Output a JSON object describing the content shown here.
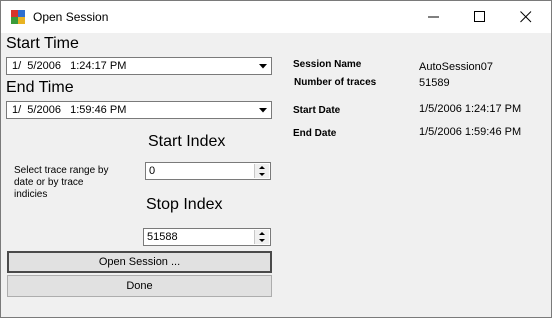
{
  "window": {
    "title": "Open Session",
    "controls": {
      "minimize": "minimize-icon",
      "maximize": "maximize-icon",
      "close": "close-icon"
    }
  },
  "form": {
    "start_time_label": "Start Time",
    "start_time_value": "1/  5/2006   1:24:17 PM",
    "end_time_label": "End Time",
    "end_time_value": "1/  5/2006   1:59:46 PM",
    "start_index_label": "Start Index",
    "start_index_value": "0",
    "stop_index_label": "Stop Index",
    "stop_index_value": "51588",
    "range_hint": "Select trace range by\ndate or by trace\nindicies",
    "open_button": "Open Session ...",
    "done_button": "Done"
  },
  "info": {
    "session_name_label": "Session Name",
    "session_name_value": "AutoSession07",
    "num_traces_label": "Number of traces",
    "num_traces_value": "51589",
    "start_date_label": "Start Date",
    "start_date_value": "1/5/2006 1:24:17 PM",
    "end_date_label": "End Date",
    "end_date_value": "1/5/2006 1:59:46 PM"
  },
  "colors": {
    "window_bg": "#f0f0f0",
    "titlebar_bg": "#ffffff",
    "button_bg": "#e1e1e1"
  }
}
